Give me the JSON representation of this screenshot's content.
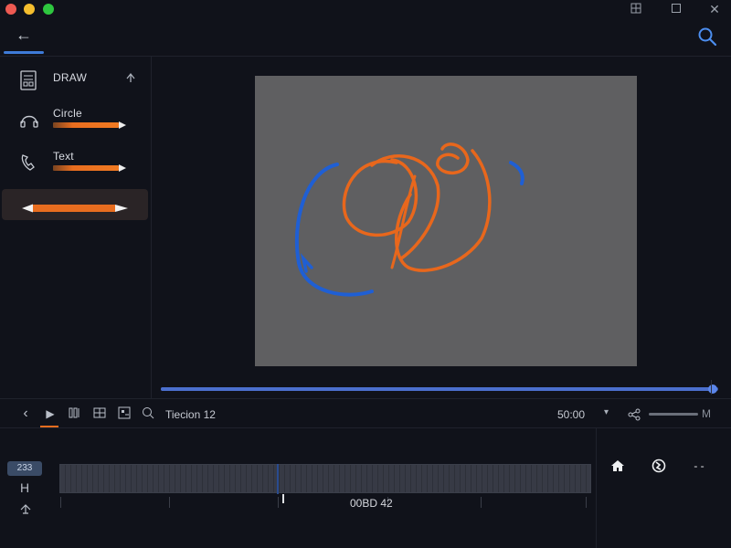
{
  "window": {
    "controls": {
      "tile": "⊞",
      "maximize": "☐",
      "close": "✕"
    }
  },
  "toolbar": {
    "back_icon": "←",
    "search_icon": "search-icon"
  },
  "sidebar": {
    "items": [
      {
        "label": "DRAW",
        "icon": "document-icon"
      },
      {
        "label": "Circle",
        "icon": "headphones-icon"
      },
      {
        "label": "Text",
        "icon": "phone-icon"
      }
    ],
    "selected_tool": "pencil-tool"
  },
  "canvas": {
    "progress_fraction": 0.99,
    "colors": {
      "background": "#5f5f61",
      "stroke_orange": "#e8671c",
      "stroke_blue": "#1f5fd4"
    }
  },
  "playbar": {
    "prev_icon": "‹",
    "play_icon": "▶",
    "label": "Tiecion 12",
    "time": "50:00",
    "dropdown_icon": "▾",
    "volume_label": "M"
  },
  "timeline": {
    "badge": "233",
    "track_letter": "H",
    "timecode": "00BD 42",
    "right_buttons": [
      "home-icon",
      "globe-icon",
      "more-icon"
    ],
    "more_label": "- -"
  },
  "colors": {
    "accent_blue": "#3e7bd8",
    "accent_orange": "#e86d1f",
    "bg": "#10121a"
  }
}
